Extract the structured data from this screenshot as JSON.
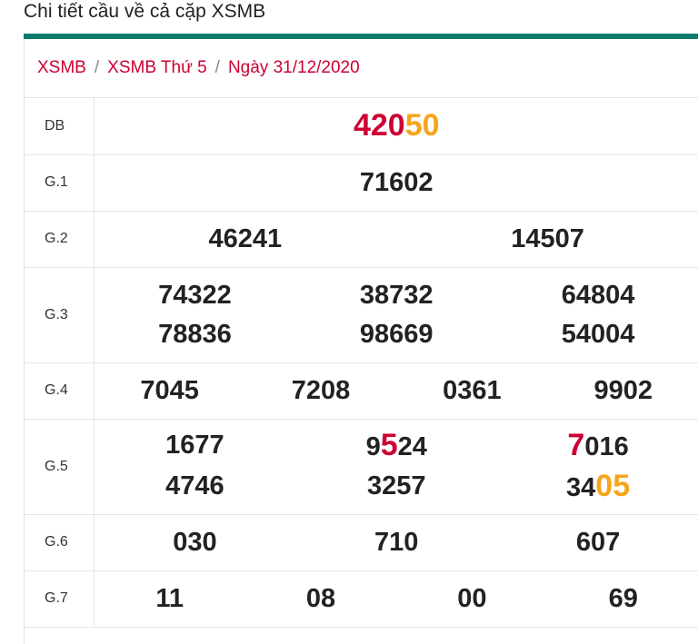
{
  "page_title": "Chi tiết cầu về cả cặp XSMB",
  "colors": {
    "accent_bar": "#0e7b6e",
    "link_red": "#cc0033",
    "highlight_orange": "#f7a51a"
  },
  "breadcrumb": [
    {
      "label": "XSMB"
    },
    {
      "label": "XSMB Thứ 5"
    },
    {
      "label": "Ngày 31/12/2020"
    }
  ],
  "breadcrumb_separator": "/",
  "prizes": {
    "db": {
      "label": "DB",
      "value_part1": "420",
      "value_part2": "50"
    },
    "g1": {
      "label": "G.1",
      "values": [
        "71602"
      ]
    },
    "g2": {
      "label": "G.2",
      "values": [
        "46241",
        "14507"
      ]
    },
    "g3": {
      "label": "G.3",
      "values": [
        "74322",
        "38732",
        "64804",
        "78836",
        "98669",
        "54004"
      ]
    },
    "g4": {
      "label": "G.4",
      "values": [
        "7045",
        "7208",
        "0361",
        "9902"
      ]
    },
    "g5": {
      "label": "G.5",
      "values": [
        "1677",
        "9524",
        "7016",
        "4746",
        "3257",
        "3405"
      ],
      "v2": {
        "pre": "9",
        "hl": "5",
        "post": "24"
      },
      "v3": {
        "hl": "7",
        "post": "016"
      },
      "v6": {
        "pre": "34",
        "hl": "05"
      }
    },
    "g6": {
      "label": "G.6",
      "values": [
        "030",
        "710",
        "607"
      ]
    },
    "g7": {
      "label": "G.7",
      "values": [
        "11",
        "08",
        "00",
        "69"
      ]
    }
  }
}
